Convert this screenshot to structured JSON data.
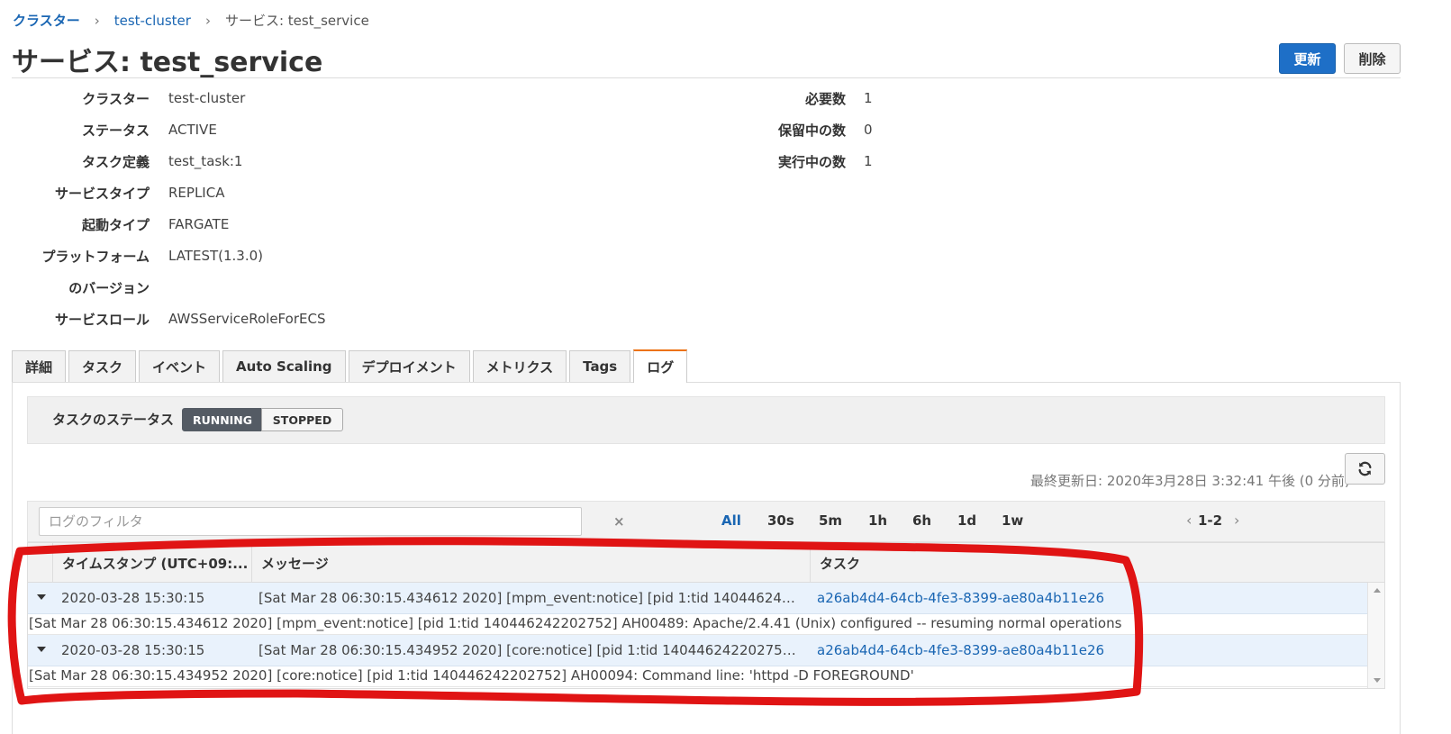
{
  "breadcrumb": {
    "root": "クラスター",
    "cluster": "test-cluster",
    "current": "サービス: test_service",
    "separator": "›"
  },
  "page_title": "サービス: test_service",
  "buttons": {
    "update": "更新",
    "delete": "削除",
    "refresh_icon": "refresh-icon"
  },
  "details_left": [
    {
      "label": "クラスター",
      "value": "test-cluster",
      "kind": "link"
    },
    {
      "label": "ステータス",
      "value": "ACTIVE",
      "kind": "status"
    },
    {
      "label": "タスク定義",
      "value": "test_task:1",
      "kind": "link"
    },
    {
      "label": "サービスタイプ",
      "value": "REPLICA",
      "kind": "text"
    },
    {
      "label": "起動タイプ",
      "value": "FARGATE",
      "kind": "text"
    },
    {
      "label": "プラットフォーム",
      "value": "LATEST(1.3.0)",
      "kind": "text"
    },
    {
      "label": "のバージョン",
      "value": "",
      "kind": "text"
    },
    {
      "label": "サービスロール",
      "value": "AWSServiceRoleForECS",
      "kind": "text"
    }
  ],
  "details_right": [
    {
      "label": "必要数",
      "value": "1"
    },
    {
      "label": "保留中の数",
      "value": "0"
    },
    {
      "label": "実行中の数",
      "value": "1"
    }
  ],
  "tabs": [
    "詳細",
    "タスク",
    "イベント",
    "Auto Scaling",
    "デプロイメント",
    "メトリクス",
    "Tags",
    "ログ"
  ],
  "active_tab": "ログ",
  "task_status": {
    "label": "タスクのステータス",
    "options": [
      "RUNNING",
      "STOPPED"
    ],
    "selected": "RUNNING"
  },
  "last_updated": "最終更新日: 2020年3月28日 3:32:41 午後 (0 分前)",
  "log_filter": {
    "placeholder": "ログのフィルタ",
    "value": "",
    "clear_icon": "×"
  },
  "time_ranges": [
    "All",
    "30s",
    "5m",
    "1h",
    "6h",
    "1d",
    "1w"
  ],
  "selected_range": "All",
  "pager": {
    "prev": "‹",
    "range": "1-2",
    "next": "›"
  },
  "columns": [
    "タイムスタンプ (UTC+09:...",
    "メッセージ",
    "タスク"
  ],
  "log_rows": [
    {
      "timestamp": "2020-03-28 15:30:15",
      "message": "[Sat Mar 28 06:30:15.434612 2020] [mpm_event:notice] [pid 1:tid 140446242202752] AH00489: Apache/2.4.41 (Unix) configured -- resuming normal operations",
      "task": "a26ab4d4-64cb-4fe3-8399-ae80a4b11e26"
    },
    {
      "timestamp": "2020-03-28 15:30:15",
      "message": "[Sat Mar 28 06:30:15.434952 2020] [core:notice] [pid 1:tid 140446242202752] AH00094: Command line: 'httpd -D FOREGROUND'",
      "task": "a26ab4d4-64cb-4fe3-8399-ae80a4b11e26"
    }
  ],
  "colors": {
    "accent": "#1e6fc7",
    "link": "#1a66b3",
    "active_status": "#23a03c",
    "active_tab_border": "#ec7211",
    "annotation": "#e01414"
  }
}
